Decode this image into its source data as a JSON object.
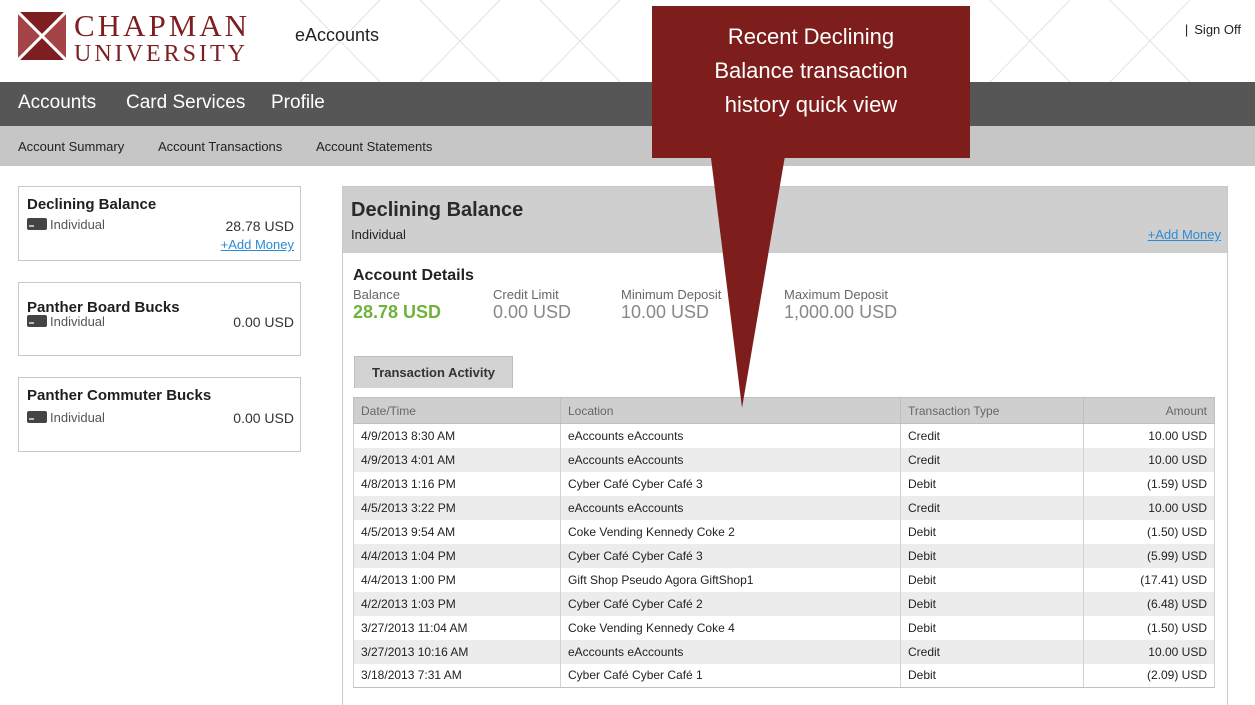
{
  "header": {
    "brand_line1": "CHAPMAN",
    "brand_line2": "UNIVERSITY",
    "app_name": "eAccounts",
    "signoff_sep": "|",
    "signoff": "Sign Off"
  },
  "nav_main": [
    "Accounts",
    "Card Services",
    "Profile"
  ],
  "nav_sub": [
    "Account Summary",
    "Account Transactions",
    "Account Statements"
  ],
  "accounts": [
    {
      "title": "Declining Balance",
      "type": "Individual",
      "amount": "28.78 USD",
      "add_money": "+Add Money"
    },
    {
      "title": "Panther Board Bucks",
      "type": "Individual",
      "amount": "0.00 USD"
    },
    {
      "title": "Panther Commuter Bucks",
      "type": "Individual",
      "amount": "0.00 USD"
    }
  ],
  "panel": {
    "title": "Declining Balance",
    "subtitle": "Individual",
    "add_money": "+Add Money",
    "details_title": "Account Details",
    "details": [
      {
        "label": "Balance",
        "value": "28.78 USD"
      },
      {
        "label": "Credit Limit",
        "value": "0.00 USD"
      },
      {
        "label": "Minimum Deposit",
        "value": "10.00 USD"
      },
      {
        "label": "Maximum Deposit",
        "value": "1,000.00 USD"
      }
    ],
    "tab": "Transaction Activity",
    "columns": [
      "Date/Time",
      "Location",
      "Transaction Type",
      "Amount"
    ],
    "rows": [
      [
        "4/9/2013 8:30 AM",
        "eAccounts eAccounts",
        "Credit",
        "10.00 USD"
      ],
      [
        "4/9/2013 4:01 AM",
        "eAccounts eAccounts",
        "Credit",
        "10.00 USD"
      ],
      [
        "4/8/2013 1:16 PM",
        "Cyber Café Cyber Café 3",
        "Debit",
        "(1.59) USD"
      ],
      [
        "4/5/2013 3:22 PM",
        "eAccounts eAccounts",
        "Credit",
        "10.00 USD"
      ],
      [
        "4/5/2013 9:54 AM",
        "Coke Vending Kennedy Coke 2",
        "Debit",
        "(1.50) USD"
      ],
      [
        "4/4/2013 1:04 PM",
        "Cyber Café Cyber Café 3",
        "Debit",
        "(5.99) USD"
      ],
      [
        "4/4/2013 1:00 PM",
        "Gift Shop Pseudo Agora GiftShop1",
        "Debit",
        "(17.41) USD"
      ],
      [
        "4/2/2013 1:03 PM",
        "Cyber Café Cyber Café 2",
        "Debit",
        "(6.48) USD"
      ],
      [
        "3/27/2013 11:04 AM",
        "Coke Vending Kennedy Coke 4",
        "Debit",
        "(1.50) USD"
      ],
      [
        "3/27/2013 10:16 AM",
        "eAccounts eAccounts",
        "Credit",
        "10.00 USD"
      ],
      [
        "3/18/2013 7:31 AM",
        "Cyber Café Cyber Café 1",
        "Debit",
        "(2.09) USD"
      ]
    ]
  },
  "callout": {
    "lines": [
      "Recent Declining",
      "Balance transaction",
      "history quick view"
    ]
  },
  "colors": {
    "brand": "#7d1e21",
    "nav_main_bg": "#565656",
    "nav_sub_bg": "#c6c6c6",
    "balance_green": "#6fb33a",
    "link_blue": "#2a8bd6",
    "callout_bg": "#7d1e1c"
  }
}
